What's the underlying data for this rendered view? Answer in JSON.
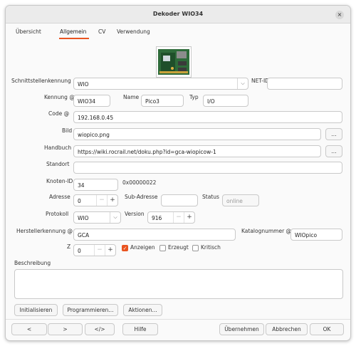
{
  "window": {
    "title": "Dekoder WIO34",
    "close_symbol": "×"
  },
  "tabs": [
    "Übersicht",
    "Allgemein",
    "CV",
    "Verwendung"
  ],
  "form": {
    "interface_label": "Schnittstellenkennung",
    "interface_value": "WIO",
    "netid_label": "NET-ID",
    "netid_value": "",
    "kennung_label": "Kennung @",
    "kennung_value": "WIO34",
    "name_label": "Name",
    "name_value": "Pico3",
    "typ_label": "Typ",
    "typ_value": "I/O",
    "code_label": "Code @",
    "code_value": "192.168.0.45",
    "bild_label": "Bild",
    "bild_value": "wiopico.png",
    "handbuch_label": "Handbuch",
    "handbuch_value": "https://wiki.rocrail.net/doku.php?id=gca-wiopicow-1",
    "standort_label": "Standort",
    "standort_value": "",
    "knoten_label": "Knoten-ID",
    "knoten_value": "34",
    "knoten_hex": "0x00000022",
    "adresse_label": "Adresse",
    "adresse_value": "0",
    "subadresse_label": "Sub-Adresse",
    "subadresse_value": "",
    "status_label": "Status",
    "status_value": "online",
    "protokoll_label": "Protokoll",
    "protokoll_value": "WIO",
    "version_label": "Version",
    "version_value": "916",
    "hersteller_label": "Herstellerkennung @",
    "hersteller_value": "GCA",
    "katalog_label": "Katalognummer @",
    "katalog_value": "WIOpico",
    "z_label": "Z",
    "z_value": "0",
    "anzeigen_label": "Anzeigen",
    "erzeugt_label": "Erzeugt",
    "kritisch_label": "Kritisch",
    "beschreibung_label": "Beschreibung",
    "ellipsis": "..."
  },
  "actions": [
    "Initialisieren",
    "Programmieren...",
    "Aktionen..."
  ],
  "footer": {
    "prev": "<",
    "next": ">",
    "code": "</>",
    "hilfe": "Hilfe",
    "uebernehmen": "Übernehmen",
    "abbrechen": "Abbrechen",
    "ok": "OK"
  },
  "symbols": {
    "dropdown": "⌵",
    "minus": "−",
    "plus": "+",
    "check": "✓"
  }
}
